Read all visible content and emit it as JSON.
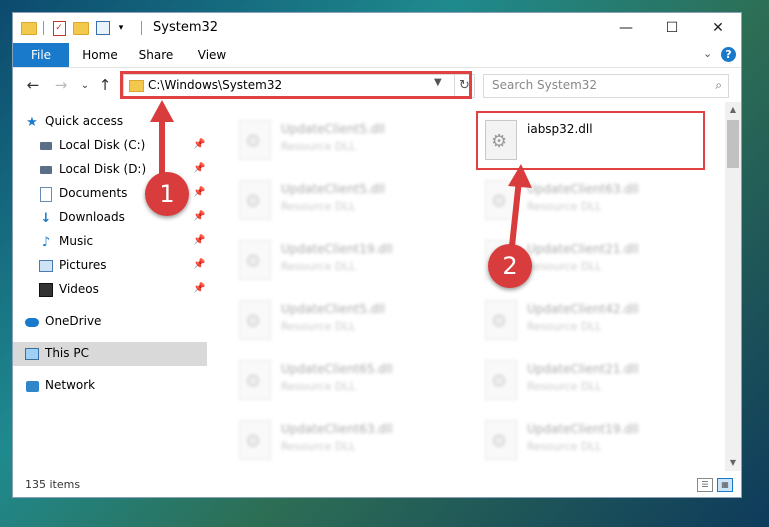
{
  "window": {
    "title": "System32",
    "controls": {
      "minimize": "—",
      "maximize": "☐",
      "close": "✕"
    }
  },
  "ribbon": {
    "tabs": [
      "File",
      "Home",
      "Share",
      "View"
    ],
    "collapse_glyph": "⌄",
    "help_glyph": "?"
  },
  "nav": {
    "back": "←",
    "forward": "→",
    "recent": "⌄",
    "up": "↑",
    "address": "C:\\Windows\\System32",
    "refresh": "↻",
    "search_placeholder": "Search System32",
    "search_icon": "⌕"
  },
  "sidebar": {
    "items": [
      {
        "label": "Quick access",
        "icon": "star-icon",
        "pinned": false
      },
      {
        "label": "Local Disk (C:)",
        "icon": "drive-icon",
        "pinned": true
      },
      {
        "label": "Local Disk (D:)",
        "icon": "drive-icon",
        "pinned": true
      },
      {
        "label": "Documents",
        "icon": "documents-icon",
        "pinned": true
      },
      {
        "label": "Downloads",
        "icon": "downloads-icon",
        "pinned": true
      },
      {
        "label": "Music",
        "icon": "music-icon",
        "pinned": true
      },
      {
        "label": "Pictures",
        "icon": "pictures-icon",
        "pinned": true
      },
      {
        "label": "Videos",
        "icon": "videos-icon",
        "pinned": true
      },
      {
        "label": "OneDrive",
        "icon": "cloud-icon",
        "pinned": false
      },
      {
        "label": "This PC",
        "icon": "computer-icon",
        "pinned": false,
        "selected": true
      },
      {
        "label": "Network",
        "icon": "network-icon",
        "pinned": false
      }
    ],
    "pin_glyph": "📌"
  },
  "files": {
    "left_column": [
      {
        "name": "UpdateClient5.dll",
        "type": "Resource DLL"
      },
      {
        "name": "UpdateClient5.dll",
        "type": "Resource DLL"
      },
      {
        "name": "UpdateClient19.dll",
        "type": "Resource DLL"
      },
      {
        "name": "UpdateClient5.dll",
        "type": "Resource DLL"
      },
      {
        "name": "UpdateClient65.dll",
        "type": "Resource DLL"
      },
      {
        "name": "UpdateClient63.dll",
        "type": "Resource DLL"
      }
    ],
    "right_column": [
      {
        "name": "iabsp32.dll",
        "type": ""
      },
      {
        "name": "UpdateClient63.dll",
        "type": "Resource DLL"
      },
      {
        "name": "UpdateClient21.dll",
        "type": "Resource DLL"
      },
      {
        "name": "UpdateClient42.dll",
        "type": "Resource DLL"
      },
      {
        "name": "UpdateClient21.dll",
        "type": "Resource DLL"
      },
      {
        "name": "UpdateClient19.dll",
        "type": "Resource DLL"
      }
    ]
  },
  "status": {
    "items_count": "135 items"
  },
  "callouts": {
    "step1": "1",
    "step2": "2"
  },
  "colors": {
    "accent": "#1979ca",
    "callout": "#e04141",
    "badge": "#d83c3c"
  }
}
